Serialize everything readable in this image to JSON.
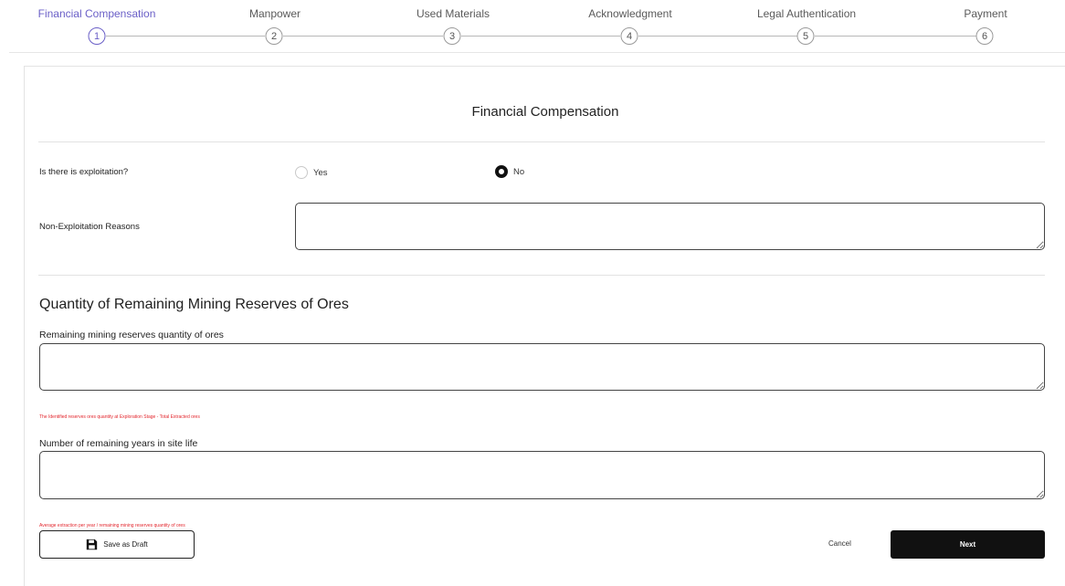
{
  "stepper": {
    "steps": [
      {
        "label": "Financial Compensation",
        "number": "1"
      },
      {
        "label": "Manpower",
        "number": "2"
      },
      {
        "label": "Used Materials",
        "number": "3"
      },
      {
        "label": "Acknowledgment",
        "number": "4"
      },
      {
        "label": "Legal Authentication",
        "number": "5"
      },
      {
        "label": "Payment",
        "number": "6"
      }
    ],
    "active_color": "#6a5fc7"
  },
  "form": {
    "title": "Financial Compensation",
    "exploitation_question": "Is there is exploitation?",
    "yes_label": "Yes",
    "no_label": "No",
    "selected": "No",
    "non_exploitation_label": "Non-Exploitation Reasons",
    "non_exploitation_value": "",
    "section_title": "Quantity of Remaining Mining Reserves of Ores",
    "remaining_reserves_label": "Remaining mining reserves quantity of ores",
    "remaining_reserves_value": "",
    "remaining_reserves_hint": "The Identified reserves ores quantity at Exploration Stage - Total Extracted ores",
    "remaining_years_label": "Number of remaining years in site life",
    "remaining_years_value": "",
    "remaining_years_hint": "Average extraction per year / remaining mining reserves quantity of ores"
  },
  "actions": {
    "save_draft_label": "Save as Draft",
    "cancel_label": "Cancel",
    "next_label": "Next"
  },
  "icons": {
    "save": "floppy-disk-icon"
  }
}
